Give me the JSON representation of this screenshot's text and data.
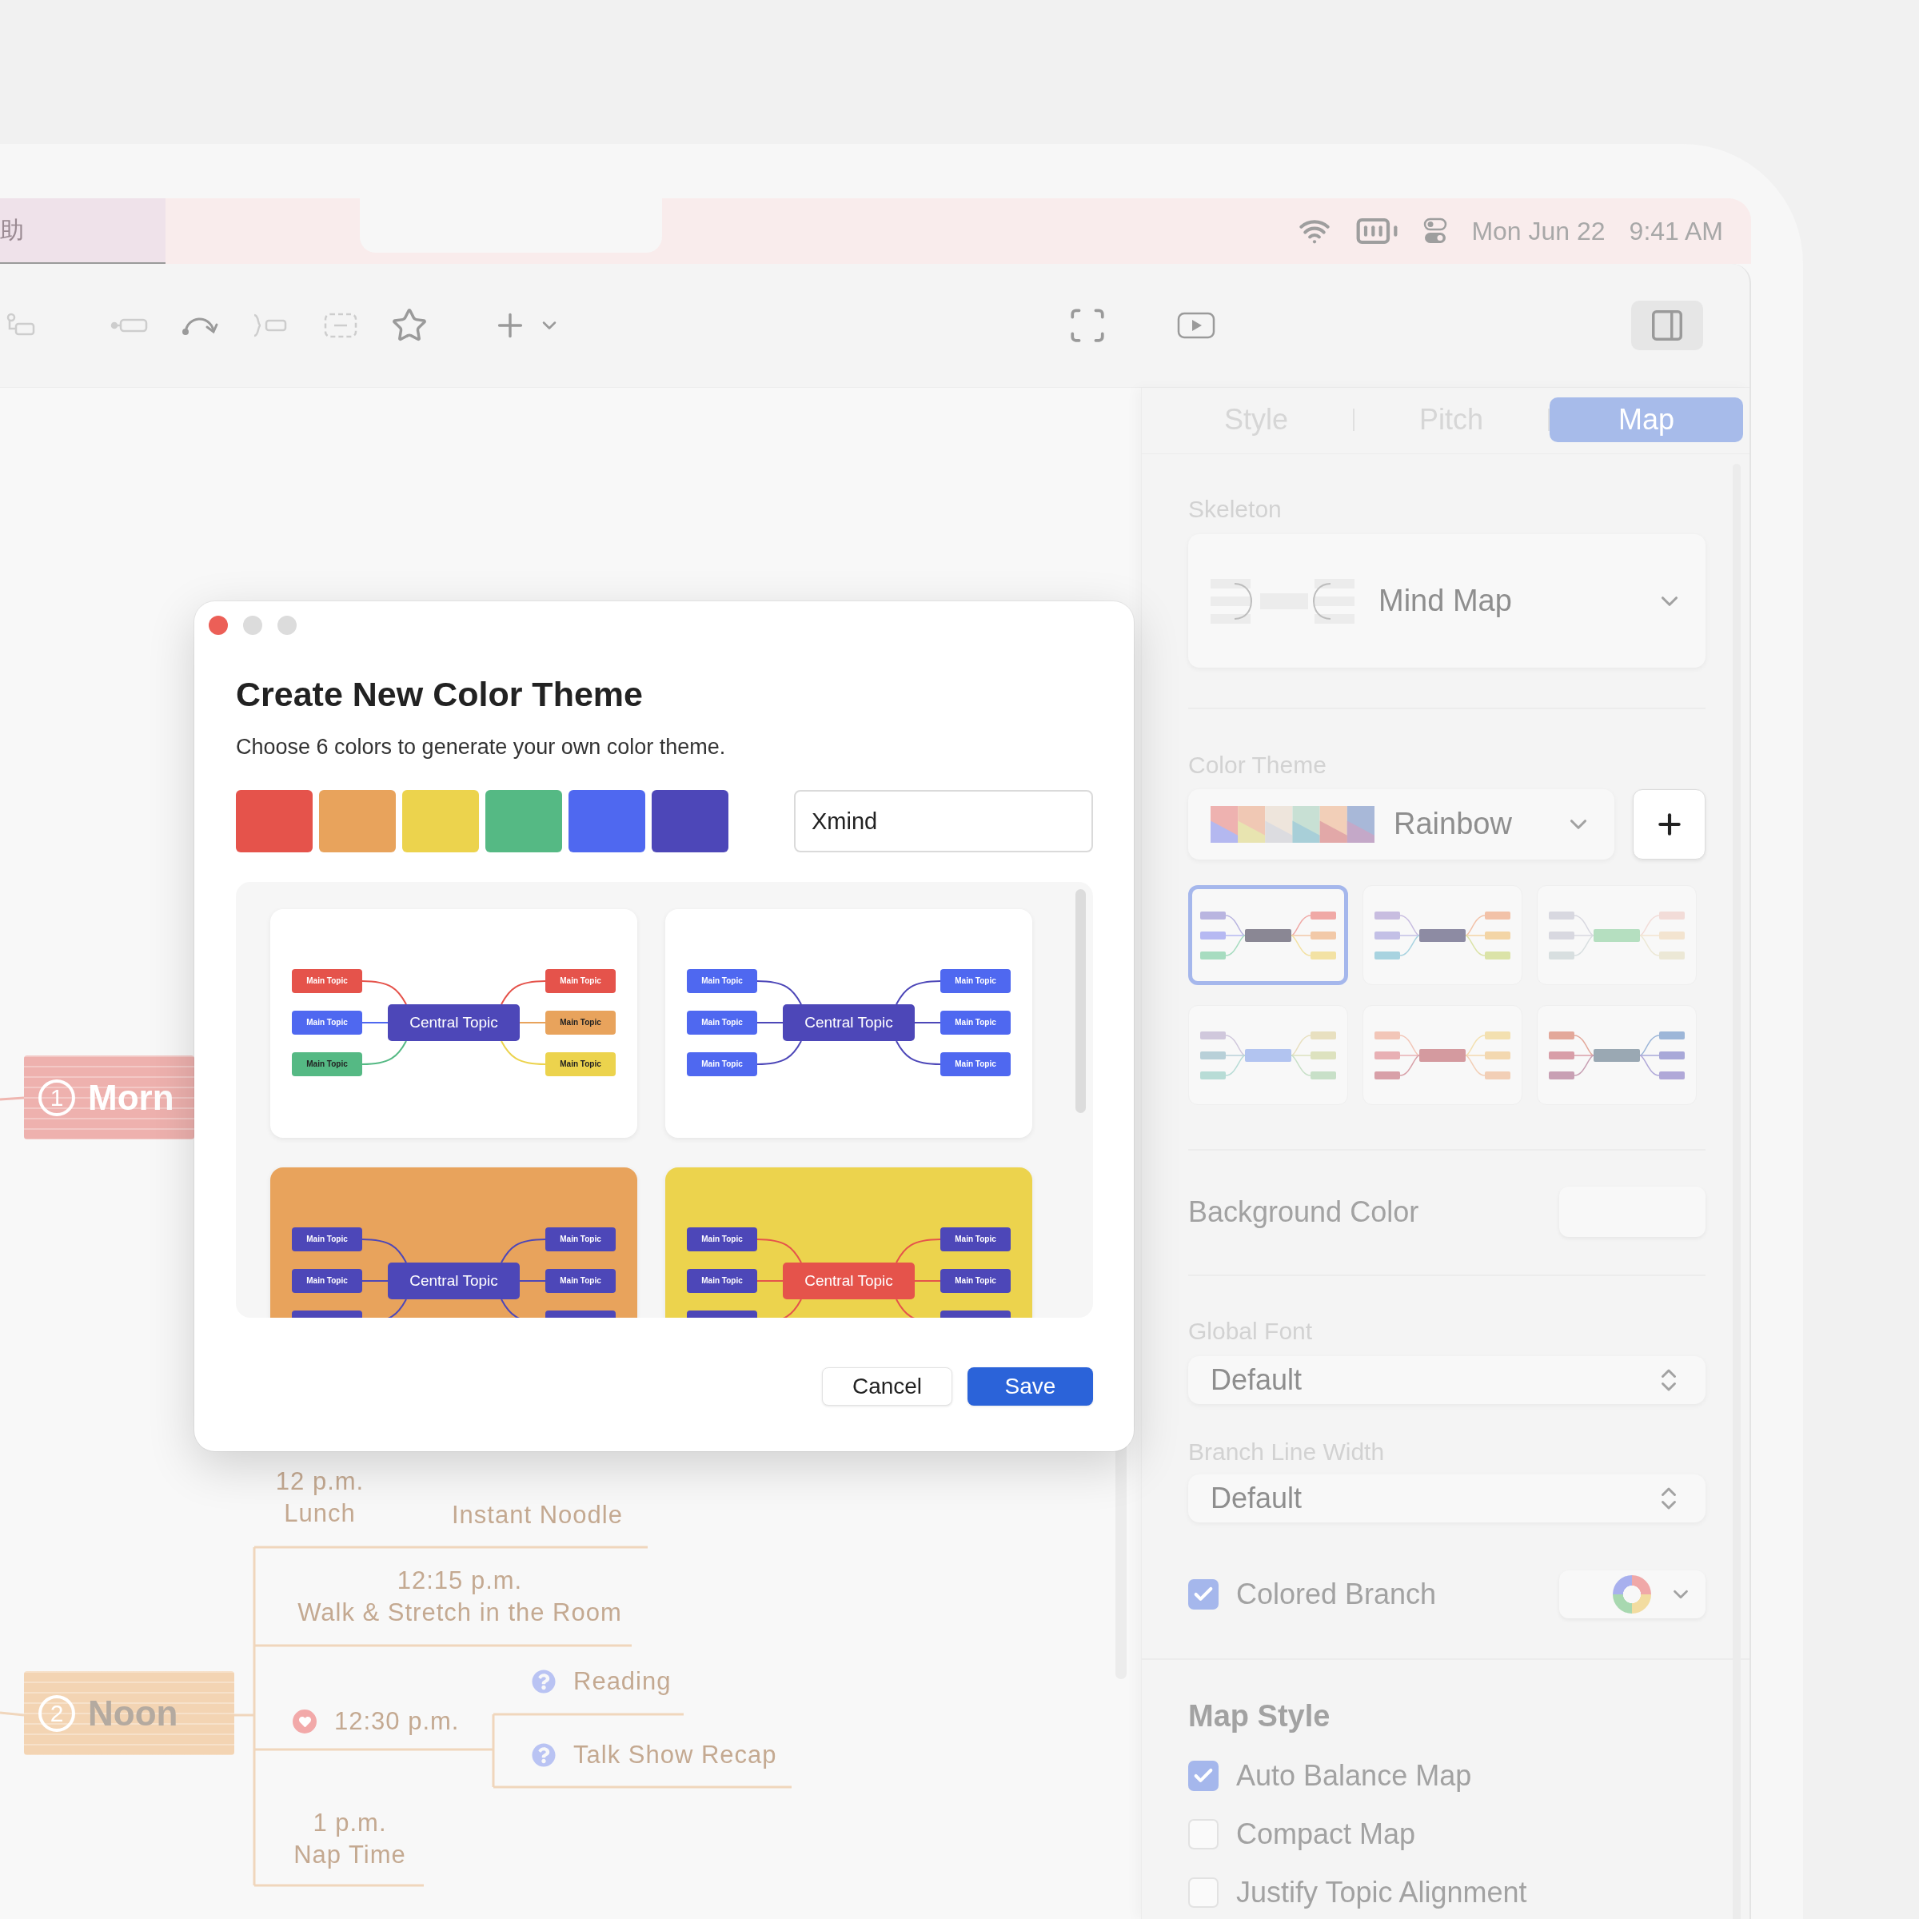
{
  "menu_bar": {
    "menu": "助",
    "date": "Mon Jun 22",
    "time": "9:41 AM"
  },
  "panel": {
    "tabs": [
      {
        "label": "Style",
        "selected": false
      },
      {
        "label": "Pitch",
        "selected": false
      },
      {
        "label": "Map",
        "selected": true
      }
    ],
    "skeleton": {
      "label": "Skeleton",
      "value": "Mind Map"
    },
    "color_theme": {
      "label": "Color Theme",
      "value": "Rainbow",
      "thumbnails": [
        {
          "color": "#8a8794",
          "branches": [
            {
              "color": "#b9b5e0"
            },
            {
              "color": "#b6b9f2"
            },
            {
              "color": "#a7dcc0"
            },
            {
              "color": "#f0a9a6"
            },
            {
              "color": "#f2c9a8"
            },
            {
              "color": "#f3e2a4"
            }
          ],
          "selected": true
        },
        {
          "color": "#8d8ba3",
          "branches": [
            {
              "color": "#c8bde0"
            },
            {
              "color": "#c3c0e6"
            },
            {
              "color": "#a8d3e0"
            },
            {
              "color": "#f2c2a8"
            },
            {
              "color": "#f3d5a6"
            },
            {
              "color": "#dbe3a8"
            }
          ],
          "selected": false
        },
        {
          "color": "#b5dfc0",
          "branches": [
            {
              "color": "#d8d8e0"
            },
            {
              "color": "#d8d8e0"
            },
            {
              "color": "#d8dfe0"
            },
            {
              "color": "#f2dcd8"
            },
            {
              "color": "#f3e4d0"
            },
            {
              "color": "#ece8d6"
            }
          ],
          "selected": false
        },
        {
          "color": "#b2c4f0",
          "branches": [
            {
              "color": "#d0c8dc"
            },
            {
              "color": "#b8d0d8"
            },
            {
              "color": "#b8dcd6"
            },
            {
              "color": "#e8e0c0"
            },
            {
              "color": "#dde2bf"
            },
            {
              "color": "#c8e0c8"
            }
          ],
          "selected": false
        },
        {
          "color": "#d49a9f",
          "branches": [
            {
              "color": "#f2c6b8"
            },
            {
              "color": "#e8b0b4"
            },
            {
              "color": "#d8a0a8"
            },
            {
              "color": "#f3e0b0"
            },
            {
              "color": "#f3d8b0"
            },
            {
              "color": "#f2cfb6"
            }
          ],
          "selected": false
        },
        {
          "color": "#9aa8b3",
          "branches": [
            {
              "color": "#e3a89a"
            },
            {
              "color": "#d89ea8"
            },
            {
              "color": "#c8a0b4"
            },
            {
              "color": "#9db6d8"
            },
            {
              "color": "#a8a8d8"
            },
            {
              "color": "#b0a8d8"
            }
          ],
          "selected": false
        }
      ]
    },
    "background_color": {
      "label": "Background Color"
    },
    "global_font": {
      "label": "Global Font",
      "value": "Default"
    },
    "branch_line_width": {
      "label": "Branch Line Width",
      "value": "Default"
    },
    "colored_branch": {
      "label": "Colored Branch",
      "checked": true
    },
    "map_style": {
      "title": "Map Style",
      "options": [
        {
          "label": "Auto Balance Map",
          "checked": true
        },
        {
          "label": "Compact Map",
          "checked": false
        },
        {
          "label": "Justify Topic Alignment",
          "checked": false
        }
      ]
    }
  },
  "canvas": {
    "branches": [
      {
        "number": "1",
        "label": "Morn",
        "color": "#eeb1ae"
      },
      {
        "number": "2",
        "label": "Noon",
        "color": "#f3d4b3"
      }
    ],
    "topics": [
      {
        "kind": "plain",
        "text": "12 p.m.\nLunch"
      },
      {
        "kind": "plain",
        "text": "Instant Noodle"
      },
      {
        "kind": "plain",
        "text": "12:15 p.m.\nWalk & Stretch in the Room"
      },
      {
        "kind": "heart",
        "text": "12:30 p.m."
      },
      {
        "kind": "question",
        "text": "Reading"
      },
      {
        "kind": "question",
        "text": "Talk Show Recap"
      },
      {
        "kind": "plain",
        "text": "1 p.m.\nNap Time"
      }
    ]
  },
  "dialog": {
    "title": "Create New Color Theme",
    "subtitle": "Choose 6 colors to generate your own color theme.",
    "swatches": [
      {
        "color": "#e5534b"
      },
      {
        "color": "#e8a35c"
      },
      {
        "color": "#ecd34d"
      },
      {
        "color": "#55b984"
      },
      {
        "color": "#4f68f0"
      },
      {
        "color": "#4d47b8"
      }
    ],
    "name": {
      "value": "Xmind"
    },
    "previews": [
      {
        "card": {
          "color": "#ffffff"
        },
        "central": {
          "label": "Central Topic",
          "color": "#4d47b8"
        },
        "topics": [
          {
            "label": "Main Topic",
            "color": "#e5534b"
          },
          {
            "label": "Main Topic",
            "color": "#4f68f0"
          },
          {
            "label": "Main Topic",
            "color": "#55b984"
          },
          {
            "label": "Main Topic",
            "color": "#e5534b"
          },
          {
            "label": "Main Topic",
            "color": "#e8a35c"
          },
          {
            "label": "Main Topic",
            "color": "#ecd34d"
          }
        ]
      },
      {
        "card": {
          "color": "#ffffff"
        },
        "line": {
          "color": "#4d47b8"
        },
        "central": {
          "label": "Central Topic",
          "color": "#4d47b8"
        },
        "topics": [
          {
            "label": "Main Topic",
            "color": "#4f68f0"
          },
          {
            "label": "Main Topic",
            "color": "#4f68f0"
          },
          {
            "label": "Main Topic",
            "color": "#4f68f0"
          },
          {
            "label": "Main Topic",
            "color": "#4f68f0"
          },
          {
            "label": "Main Topic",
            "color": "#4f68f0"
          },
          {
            "label": "Main Topic",
            "color": "#4f68f0"
          }
        ]
      },
      {
        "card": {
          "color": "#e8a35c"
        },
        "line": {
          "color": "#4d47b8"
        },
        "central": {
          "label": "Central Topic",
          "color": "#4d47b8"
        },
        "topics": [
          {
            "label": "Main Topic",
            "color": "#4d47b8"
          },
          {
            "label": "Main Topic",
            "color": "#4d47b8"
          },
          {
            "color": "#4d47b8"
          },
          {
            "label": "Main Topic",
            "color": "#4d47b8"
          },
          {
            "label": "Main Topic",
            "color": "#4d47b8"
          },
          {
            "color": "#4d47b8"
          }
        ]
      },
      {
        "card": {
          "color": "#ecd34d"
        },
        "line": {
          "color": "#e5534b"
        },
        "central": {
          "label": "Central Topic",
          "color": "#e5534b"
        },
        "topics": [
          {
            "label": "Main Topic",
            "color": "#4d47b8"
          },
          {
            "label": "Main Topic",
            "color": "#4d47b8"
          },
          {
            "color": "#4d47b8"
          },
          {
            "label": "Main Topic",
            "color": "#4d47b8"
          },
          {
            "label": "Main Topic",
            "color": "#4d47b8"
          },
          {
            "color": "#4d47b8"
          }
        ]
      }
    ],
    "buttons": [
      {
        "kind": "secondary",
        "label": "Cancel"
      },
      {
        "kind": "primary",
        "label": "Save"
      }
    ]
  }
}
